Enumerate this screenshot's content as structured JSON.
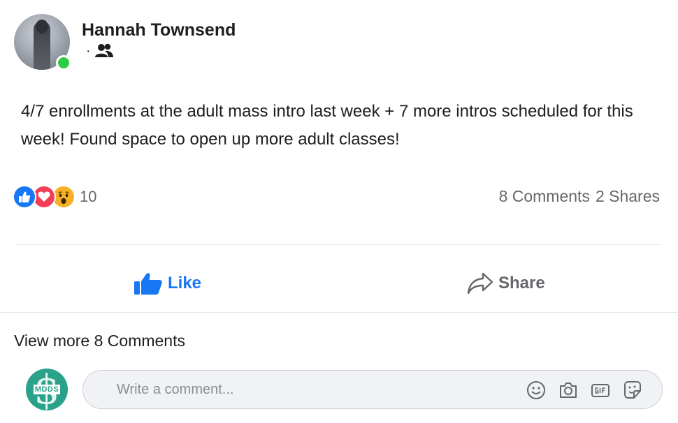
{
  "post": {
    "author": "Hannah Townsend",
    "meta_separator": "·",
    "audience_icon": "friends-icon",
    "text": "4/7 enrollments at the adult mass intro last week + 7 more intros scheduled for this week! Found space to open up more adult classes!",
    "reaction_count": "10",
    "comments_count": "8 Comments",
    "shares_count": "2 Shares"
  },
  "actions": {
    "like_label": "Like",
    "share_label": "Share"
  },
  "comments": {
    "view_more": "View more 8 Comments",
    "commenter_avatar_text": "MDDS",
    "input_placeholder": "Write a comment...",
    "input_icons": [
      "emoji-icon",
      "camera-icon",
      "gif-icon",
      "sticker-icon"
    ]
  },
  "colors": {
    "like_blue": "#1877f2",
    "love_red": "#f33e58",
    "wow_yellow": "#f7b125",
    "online_green": "#31cc46",
    "muted_text": "#65676b"
  }
}
